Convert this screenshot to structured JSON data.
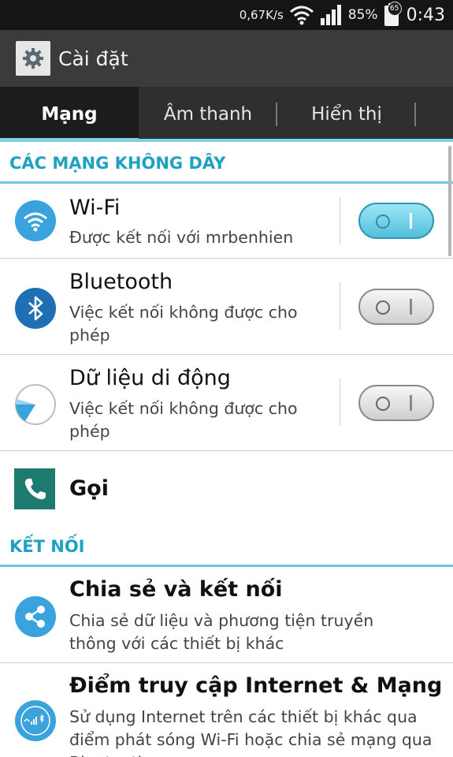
{
  "status_bar": {
    "speed": "0,67K/s",
    "battery_percent": "85%",
    "notification_count": "65",
    "time": "0:43"
  },
  "action_bar": {
    "title": "Cài đặt",
    "icon": "gear-icon"
  },
  "tabs": [
    {
      "label": "Mạng",
      "active": true
    },
    {
      "label": "Âm thanh",
      "active": false
    },
    {
      "label": "Hiển thị",
      "active": false
    }
  ],
  "sections": {
    "wireless": "CÁC MẠNG KHÔNG DÂY",
    "connect": "KẾT NỐI"
  },
  "rows": {
    "wifi": {
      "title": "Wi-Fi",
      "subtitle": "Được kết nối với mrbenhien",
      "toggle_on": true,
      "icon": "wifi-icon"
    },
    "bluetooth": {
      "title": "Bluetooth",
      "subtitle": "Việc kết nối không được cho phép",
      "toggle_on": false,
      "icon": "bluetooth-icon"
    },
    "mobile_data": {
      "title": "Dữ liệu di động",
      "subtitle": "Việc kết nối không được cho phép",
      "toggle_on": false,
      "icon": "data-usage-icon"
    },
    "call": {
      "title": "Gọi",
      "icon": "phone-icon"
    },
    "share": {
      "title": "Chia sẻ và kết nối",
      "subtitle": "Chia sẻ dữ liệu và phương tiện truyền thông với các thiết bị khác",
      "icon": "share-icon"
    },
    "hotspot": {
      "title": "Điểm truy cập Internet & Mạng",
      "subtitle": "Sử dụng Internet trên các thiết bị khác qua điểm phát sóng Wi-Fi hoặc chia sẻ mạng qua Bluetooth",
      "icon": "hotspot-icon"
    }
  },
  "colors": {
    "accent": "#1fa1c3",
    "tab_indicator": "#7fd2e3",
    "status_bar": "#151515",
    "action_bar": "#3b3b3b"
  }
}
